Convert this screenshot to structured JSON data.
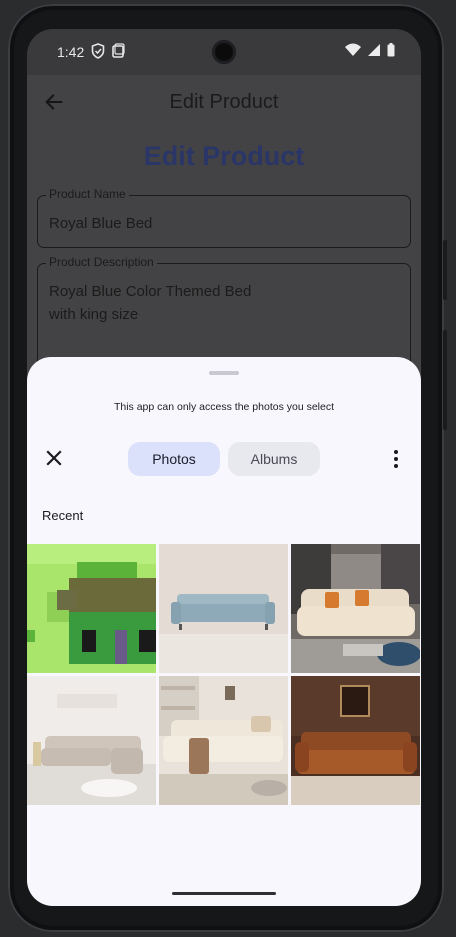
{
  "status_bar": {
    "time": "1:42",
    "left_icons": [
      "shield-icon",
      "screen-icon"
    ],
    "right_icons": [
      "wifi-icon",
      "signal-icon",
      "battery-icon"
    ]
  },
  "app_bar": {
    "title": "Edit Product",
    "back_icon": "arrow-left-icon"
  },
  "page": {
    "heading": "Edit Product",
    "fields": [
      {
        "label": "Product Name",
        "value": "Royal Blue Bed"
      },
      {
        "label": "Product Description",
        "value": "Royal Blue Color Themed Bed\nwith king size"
      }
    ]
  },
  "picker": {
    "access_note": "This app can only access the photos you select",
    "close_icon": "close-icon",
    "tabs": [
      {
        "label": "Photos",
        "selected": true
      },
      {
        "label": "Albums",
        "selected": false
      }
    ],
    "more_icon": "more-vert-icon",
    "section_label": "Recent",
    "photos": [
      {
        "name": "pixel-house-thumbnail"
      },
      {
        "name": "blue-sofa-thumbnail"
      },
      {
        "name": "tufted-beige-sofa-thumbnail"
      },
      {
        "name": "white-sectional-sofa-thumbnail"
      },
      {
        "name": "cream-sofa-living-room-thumbnail"
      },
      {
        "name": "brown-leather-sofa-thumbnail"
      }
    ]
  },
  "colors": {
    "heading": "#2a3568",
    "sheet_bg": "#f8f7fd",
    "tab_selected": "#dbe1fa",
    "tab_unselected": "#e8e8ef"
  }
}
